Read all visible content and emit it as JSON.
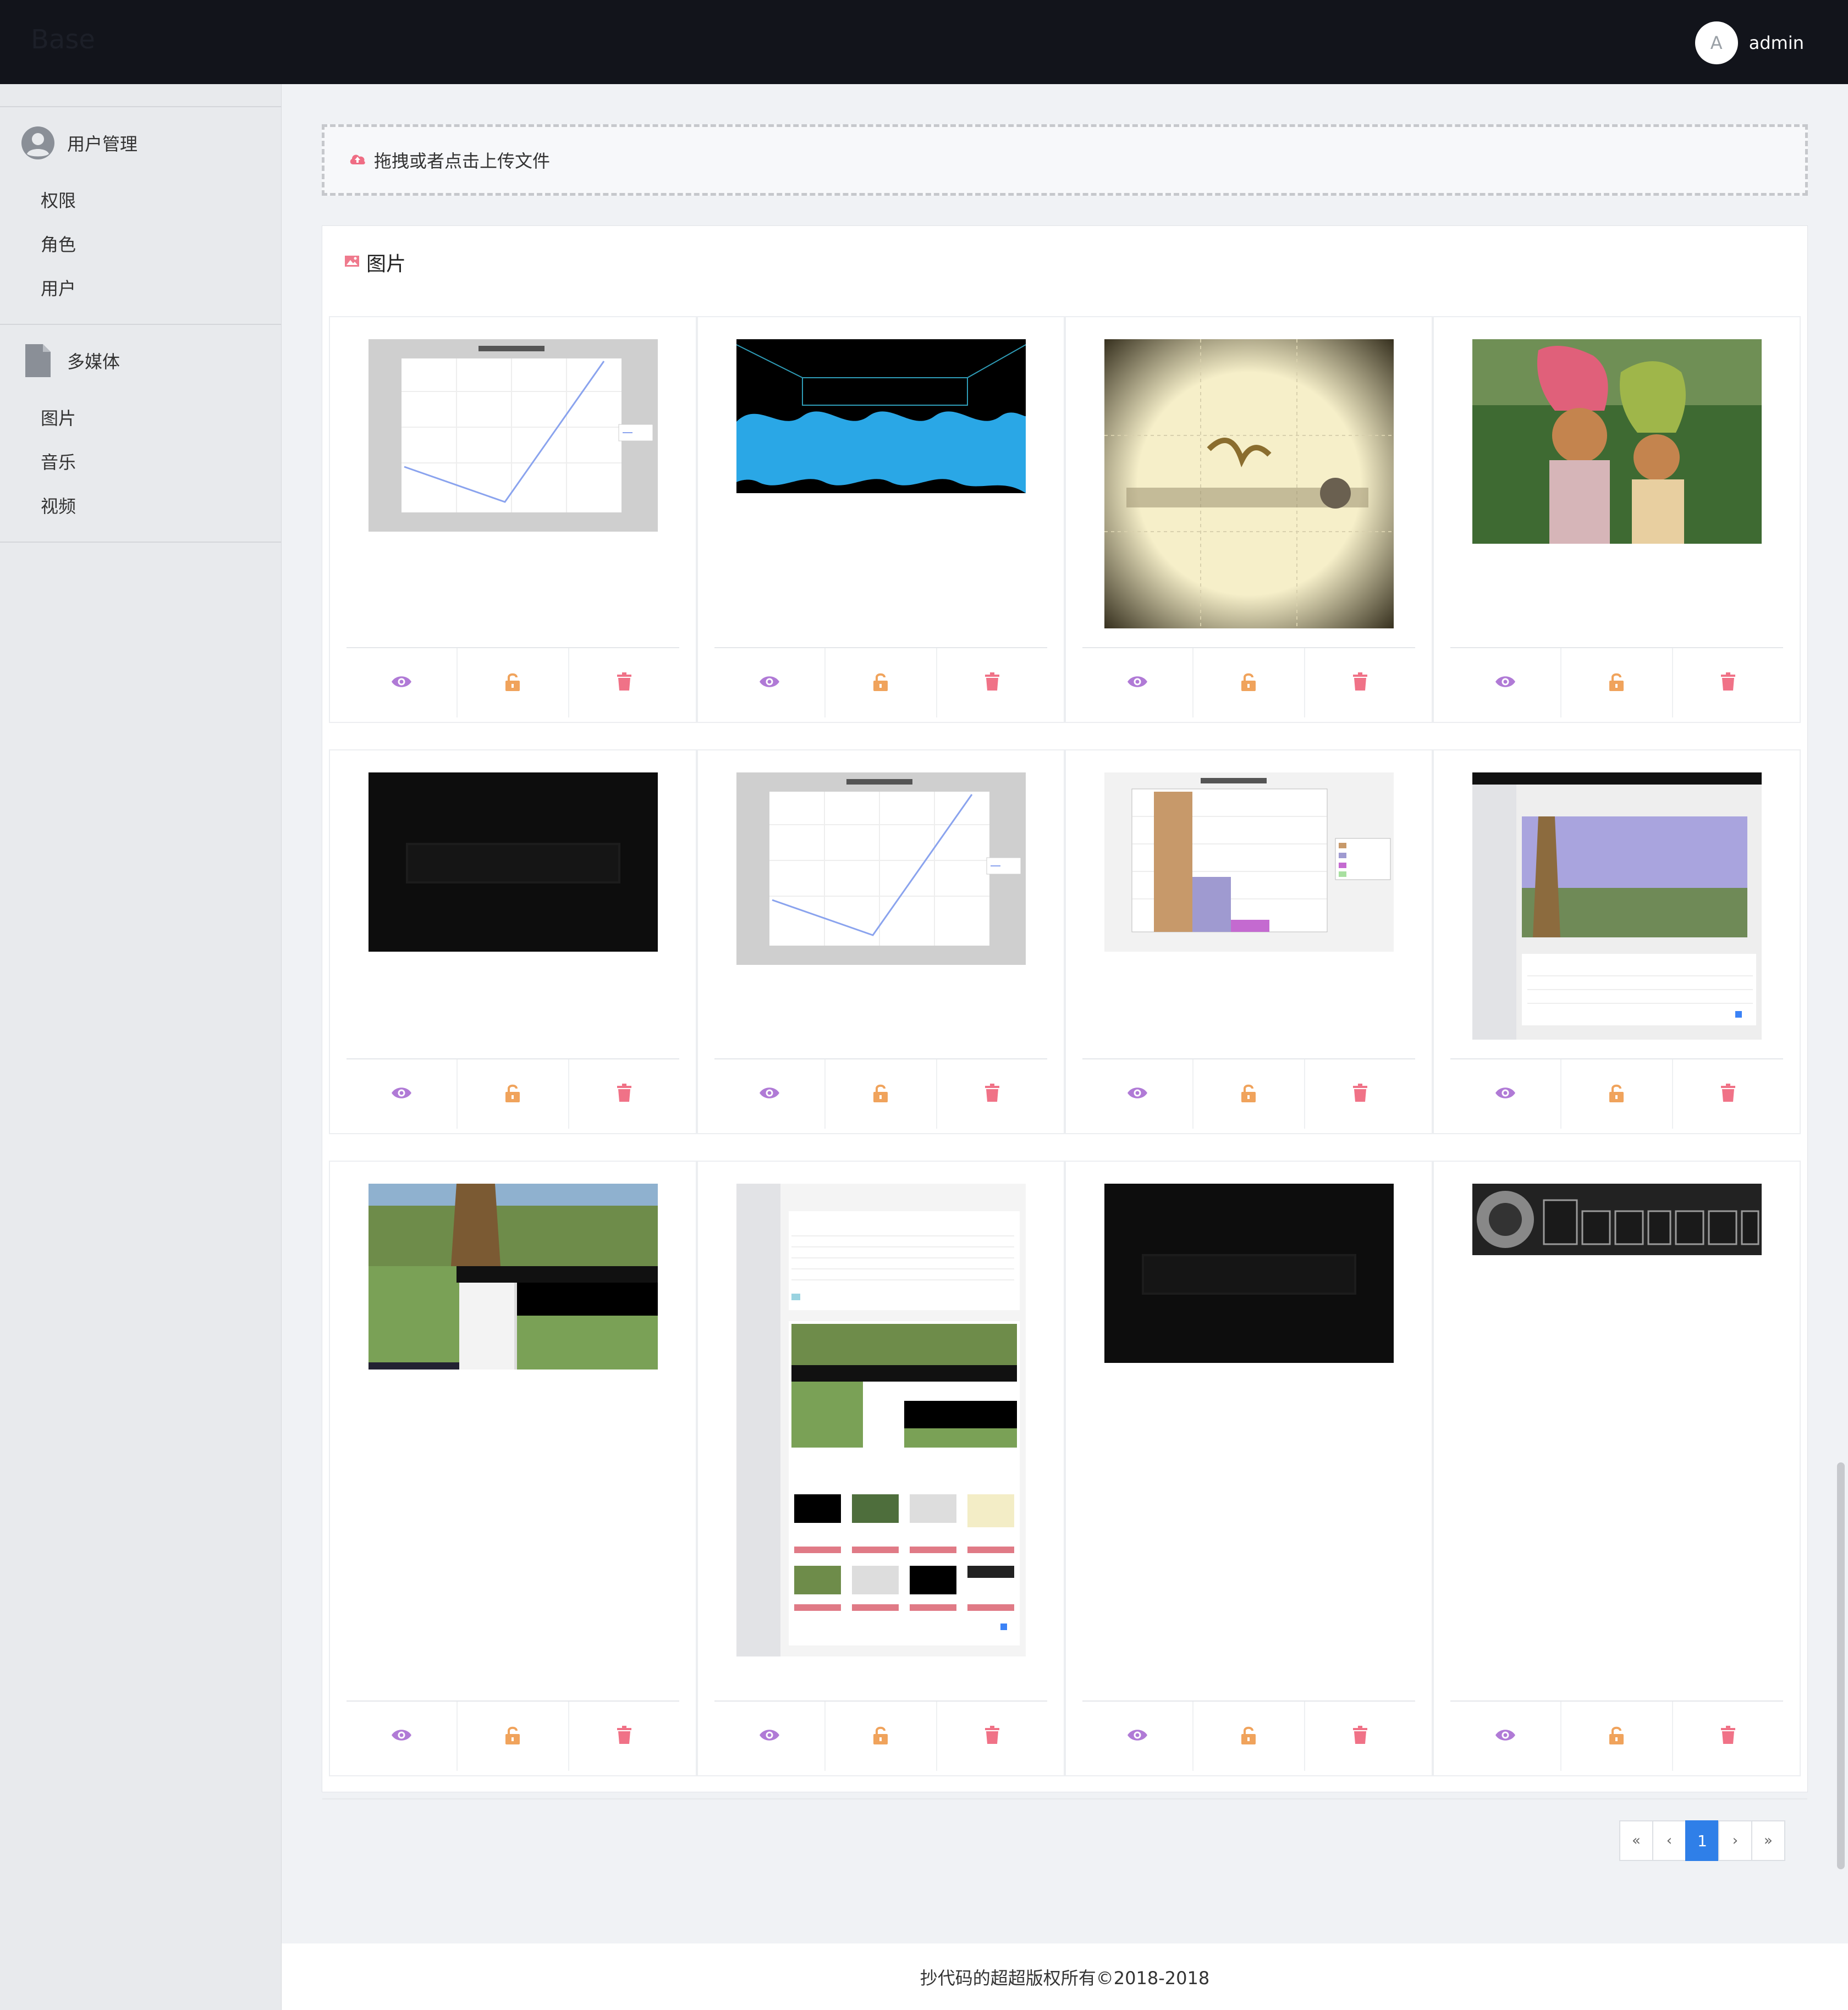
{
  "header": {
    "brand": "Base",
    "avatar_letter": "A",
    "username": "admin"
  },
  "sidebar": {
    "groups": [
      {
        "title": "用户管理",
        "icon": "user-circle-icon",
        "items": [
          "权限",
          "角色",
          "用户"
        ]
      },
      {
        "title": "多媒体",
        "icon": "file-icon",
        "items": [
          "图片",
          "音乐",
          "视频"
        ]
      }
    ]
  },
  "upload": {
    "label": "拖拽或者点击上传文件",
    "icon": "cloud-upload-icon"
  },
  "gallery": {
    "title": "图片",
    "icon": "image-icon",
    "action_icons": [
      "eye-icon",
      "unlock-icon",
      "trash-icon"
    ],
    "colors": {
      "eye": "#b07ad6",
      "lock": "#f0a35c",
      "trash": "#f07287"
    }
  },
  "pagination": {
    "first": "«",
    "prev": "‹",
    "current": "1",
    "next": "›",
    "last": "»"
  },
  "footer": {
    "text": "抄代码的超超版权所有©2018-2018"
  }
}
